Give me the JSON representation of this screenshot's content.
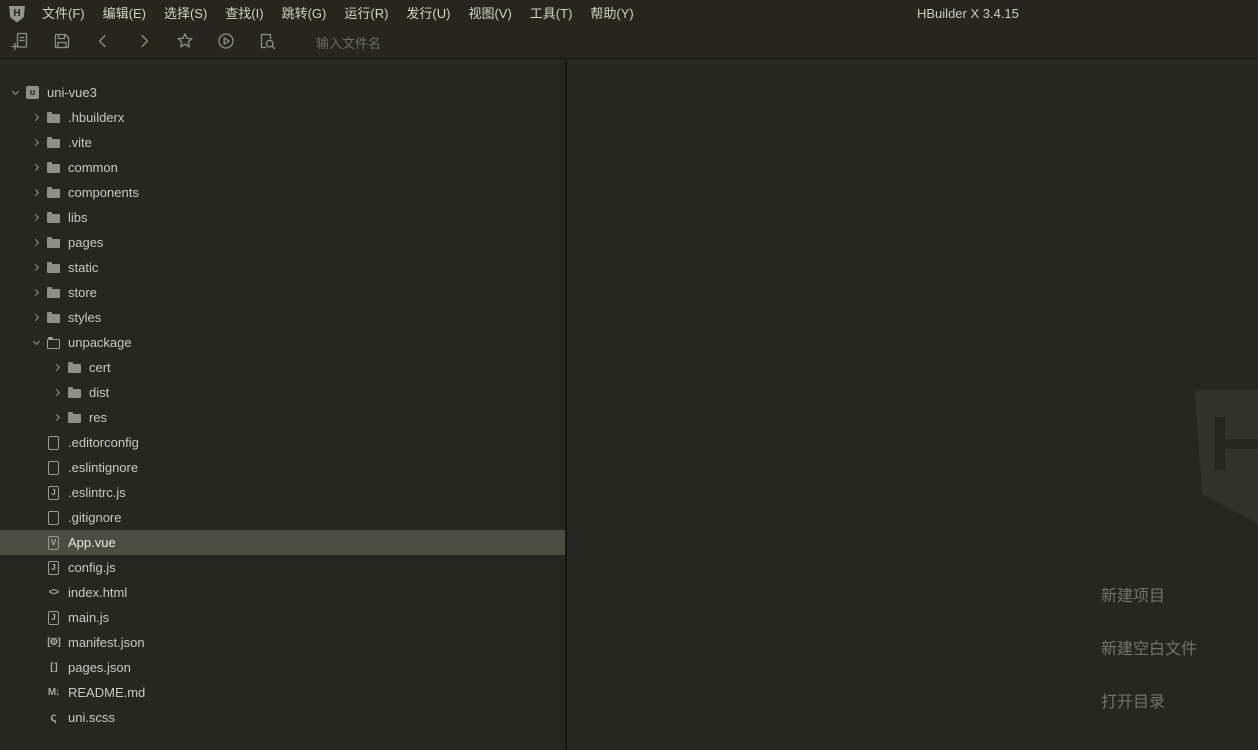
{
  "window": {
    "title": "HBuilder X 3.4.15",
    "app_logo_letter": "H"
  },
  "menubar": {
    "items": [
      "文件(F)",
      "编辑(E)",
      "选择(S)",
      "查找(I)",
      "跳转(G)",
      "运行(R)",
      "发行(U)",
      "视图(V)",
      "工具(T)",
      "帮助(Y)"
    ]
  },
  "toolbar": {
    "icons": [
      "new-file-icon",
      "save-icon",
      "back-icon",
      "forward-icon",
      "favorites-icon",
      "run-icon",
      "find-file-icon"
    ],
    "search": {
      "placeholder": "输入文件名",
      "value": ""
    }
  },
  "sidebar": {
    "tree": [
      {
        "label": "uni-vue3",
        "level": 0,
        "icon": "project-icon",
        "expanded": true
      },
      {
        "label": ".hbuilderx",
        "level": 1,
        "icon": "folder-icon",
        "expanded": false
      },
      {
        "label": ".vite",
        "level": 1,
        "icon": "folder-icon",
        "expanded": false
      },
      {
        "label": "common",
        "level": 1,
        "icon": "folder-icon",
        "expanded": false
      },
      {
        "label": "components",
        "level": 1,
        "icon": "folder-icon",
        "expanded": false
      },
      {
        "label": "libs",
        "level": 1,
        "icon": "folder-icon",
        "expanded": false
      },
      {
        "label": "pages",
        "level": 1,
        "icon": "folder-icon",
        "expanded": false
      },
      {
        "label": "static",
        "level": 1,
        "icon": "folder-icon",
        "expanded": false
      },
      {
        "label": "store",
        "level": 1,
        "icon": "folder-icon",
        "expanded": false
      },
      {
        "label": "styles",
        "level": 1,
        "icon": "folder-icon",
        "expanded": false
      },
      {
        "label": "unpackage",
        "level": 1,
        "icon": "folder-open-icon",
        "expanded": true
      },
      {
        "label": "cert",
        "level": 2,
        "icon": "folder-icon",
        "expanded": false
      },
      {
        "label": "dist",
        "level": 2,
        "icon": "folder-icon",
        "expanded": false
      },
      {
        "label": "res",
        "level": 2,
        "icon": "folder-icon",
        "expanded": false
      },
      {
        "label": ".editorconfig",
        "level": 1,
        "icon": "file-icon"
      },
      {
        "label": ".eslintignore",
        "level": 1,
        "icon": "file-icon"
      },
      {
        "label": ".eslintrc.js",
        "level": 1,
        "icon": "js-file-icon"
      },
      {
        "label": ".gitignore",
        "level": 1,
        "icon": "file-icon"
      },
      {
        "label": "App.vue",
        "level": 1,
        "icon": "vue-file-icon",
        "selected": true
      },
      {
        "label": "config.js",
        "level": 1,
        "icon": "js-file-icon"
      },
      {
        "label": "index.html",
        "level": 1,
        "icon": "html-file-icon"
      },
      {
        "label": "main.js",
        "level": 1,
        "icon": "js-file-icon"
      },
      {
        "label": "manifest.json",
        "level": 1,
        "icon": "manifest-file-icon"
      },
      {
        "label": "pages.json",
        "level": 1,
        "icon": "json-file-icon"
      },
      {
        "label": "README.md",
        "level": 1,
        "icon": "md-file-icon"
      },
      {
        "label": "uni.scss",
        "level": 1,
        "icon": "scss-file-icon"
      }
    ]
  },
  "main": {
    "watermark": "hbuilderx-logo",
    "quick_links": [
      {
        "name": "new-project-link",
        "label": "新建项目"
      },
      {
        "name": "new-blank-file-link",
        "label": "新建空白文件"
      },
      {
        "name": "open-directory-link",
        "label": "打开目录"
      }
    ]
  },
  "colors": {
    "bar_bg": "#26261f",
    "panel_bg": "#262720",
    "selected_row": "#4b4c42",
    "divider": "#151511",
    "text": "#c8c9bf",
    "dim_text": "#72736a",
    "watermark": "#32332b"
  }
}
